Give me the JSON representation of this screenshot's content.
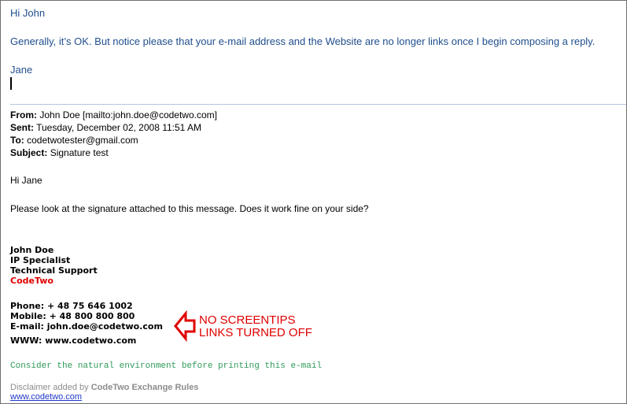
{
  "reply": {
    "greeting": "Hi John",
    "body": "Generally, it’s OK. But notice please that your e-mail address and the Website are no longer links once I begin composing a reply.",
    "signature": "Jane"
  },
  "quoted_header": {
    "from_label": "From:",
    "from_value": "John Doe [mailto:john.doe@codetwo.com]",
    "sent_label": "Sent:",
    "sent_value": "Tuesday, December 02, 2008 11:51 AM",
    "to_label": "To:",
    "to_value": "codetwotester@gmail.com",
    "subject_label": "Subject:",
    "subject_value": "Signature test"
  },
  "quoted_body": {
    "greeting": "Hi Jane",
    "text": "Please look at the signature attached to this message. Does it work fine on your side?"
  },
  "signature": {
    "name": "John Doe",
    "title": "IP Specialist",
    "department": "Technical Support",
    "company": "CodeTwo",
    "phone": "Phone: + 48 75 646 1002",
    "mobile": "Mobile: + 48 800 800 800",
    "email": "E-mail: john.doe@codetwo.com",
    "www": "WWW: www.codetwo.com"
  },
  "annotation": {
    "line1": "NO SCREENTIPS",
    "line2": "LINKS TURNED OFF"
  },
  "footer": {
    "environment": "Consider the natural environment before printing this e-mail",
    "disclaimer_prefix": "Disclaimer added by",
    "disclaimer_product": "CodeTwo Exchange Rules",
    "link": "www.codetwo.com"
  },
  "colors": {
    "reply_text": "#1f4e8c",
    "company": "#e00000",
    "annotation": "#e00000",
    "environment": "#2e9a5a",
    "link": "#1f39c8"
  },
  "icons": {
    "annotation_arrow": "left-arrow-icon"
  }
}
